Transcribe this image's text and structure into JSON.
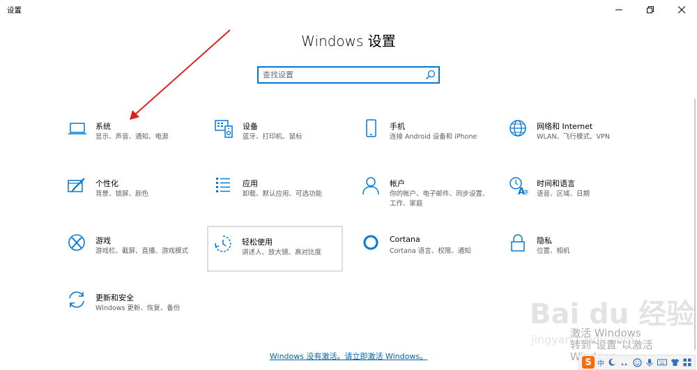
{
  "window": {
    "title": "设置"
  },
  "header": {
    "title": "Windows 设置"
  },
  "search": {
    "placeholder": "查找设置"
  },
  "tiles": [
    {
      "title": "系统",
      "desc": "显示、声音、通知、电源",
      "icon": "laptop-icon"
    },
    {
      "title": "设备",
      "desc": "蓝牙、打印机、鼠标",
      "icon": "devices-icon"
    },
    {
      "title": "手机",
      "desc": "连接 Android 设备和 iPhone",
      "icon": "phone-icon"
    },
    {
      "title": "网络和 Internet",
      "desc": "WLAN、飞行模式、VPN",
      "icon": "globe-icon"
    },
    {
      "title": "个性化",
      "desc": "背景、锁屏、颜色",
      "icon": "personalization-icon"
    },
    {
      "title": "应用",
      "desc": "卸载、默认应用、可选功能",
      "icon": "apps-list-icon"
    },
    {
      "title": "帐户",
      "desc": "你的帐户、电子邮件、同步设置、工作、家庭",
      "icon": "person-icon"
    },
    {
      "title": "时间和语言",
      "desc": "语音、区域、日期",
      "icon": "time-language-icon"
    },
    {
      "title": "游戏",
      "desc": "游戏栏、截屏、直播、游戏模式",
      "icon": "xbox-icon"
    },
    {
      "title": "轻松使用",
      "desc": "讲述人、放大镜、高对比度",
      "icon": "ease-of-access-icon"
    },
    {
      "title": "Cortana",
      "desc": "Cortana 语言、权限、通知",
      "icon": "cortana-icon"
    },
    {
      "title": "隐私",
      "desc": "位置、相机",
      "icon": "lock-icon"
    },
    {
      "title": "更新和安全",
      "desc": "Windows 更新、恢复、备份",
      "icon": "update-icon"
    }
  ],
  "footer": {
    "activate_link": "Windows 没有激活。请立即激活 Windows。"
  },
  "watermark": {
    "brand": "Bai du 经验",
    "url": "jingyan.baidu.com",
    "overlay": "激活 Windows\n转到\"设置\"以激活 Windows。"
  },
  "tray": {
    "ime": "中",
    "logo": "S"
  },
  "colors": {
    "accent": "#0078d7",
    "link": "#0063b1",
    "annotation": "#e02020"
  }
}
